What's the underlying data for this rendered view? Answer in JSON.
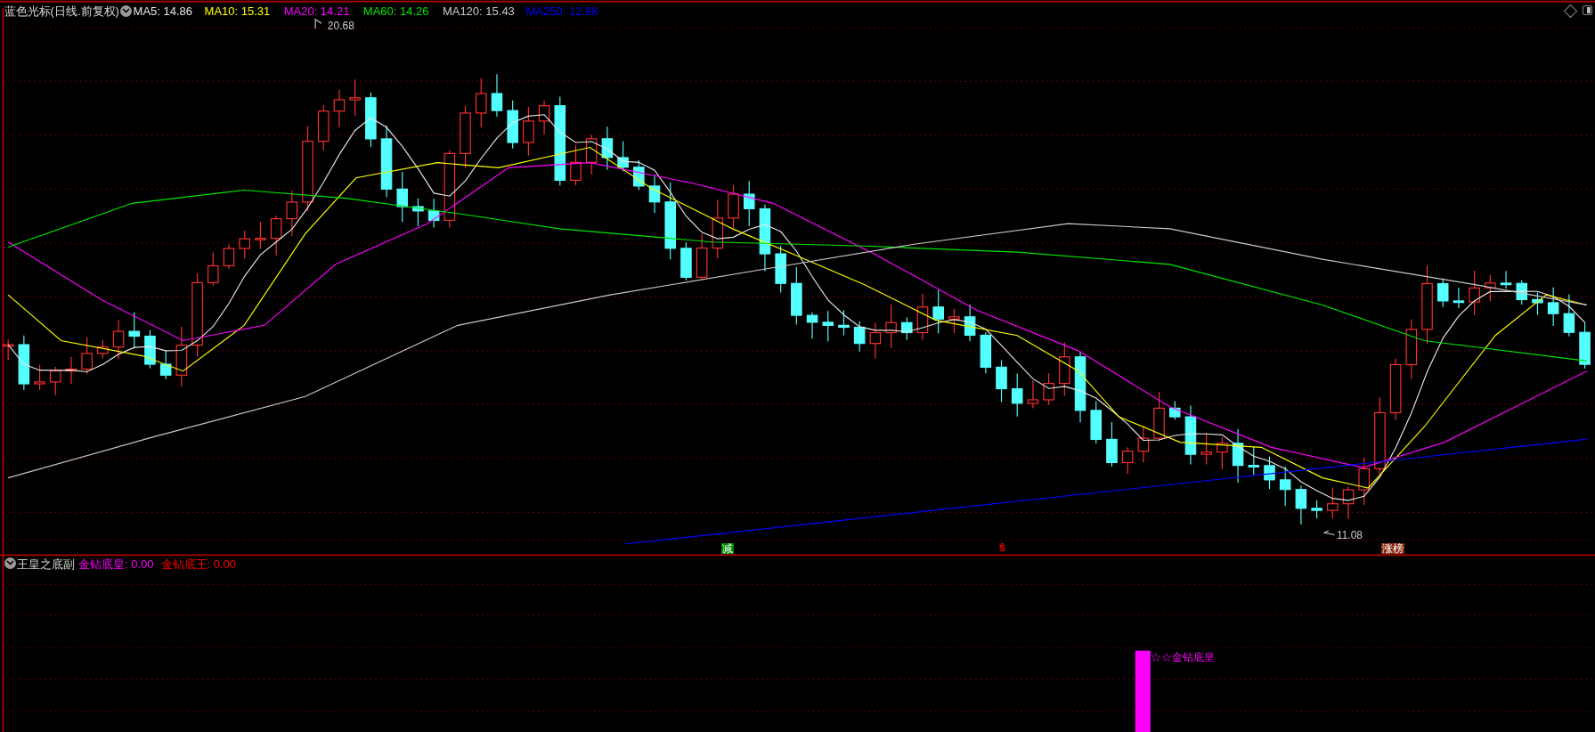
{
  "main_panel": {
    "title": "蓝色光标(日线.前复权)",
    "moving_averages": [
      {
        "label": "MA5: 14.86",
        "color": "#e6e6e6"
      },
      {
        "label": "MA10: 15.31",
        "color": "#ffff00"
      },
      {
        "label": "MA20: 14.21",
        "color": "#ff00ff"
      },
      {
        "label": "MA60: 14.26",
        "color": "#00e600"
      },
      {
        "label": "MA120: 15.43",
        "color": "#c8c8c8"
      },
      {
        "label": "MA250: 12.88",
        "color": "#0000ff"
      }
    ],
    "price_labels": [
      {
        "text": "20.68",
        "kind": "high"
      },
      {
        "text": "11.08",
        "kind": "low"
      }
    ],
    "markers": [
      {
        "text": "减",
        "kind": "boxed",
        "color": "#008800"
      },
      {
        "text": "ŝ",
        "kind": "plain",
        "color": "#ff0000"
      },
      {
        "text": "涨榜",
        "kind": "boxed",
        "color": "#8b2a10"
      }
    ]
  },
  "indicator_panel": {
    "title": "王皇之底副",
    "values": [
      {
        "label": "金钻底皇: 0.00",
        "color": "#ff00ff"
      },
      {
        "label": "金钻底王: 0.00",
        "color": "#ff0000"
      }
    ],
    "signal_label": "☆☆金钻底皇"
  }
}
